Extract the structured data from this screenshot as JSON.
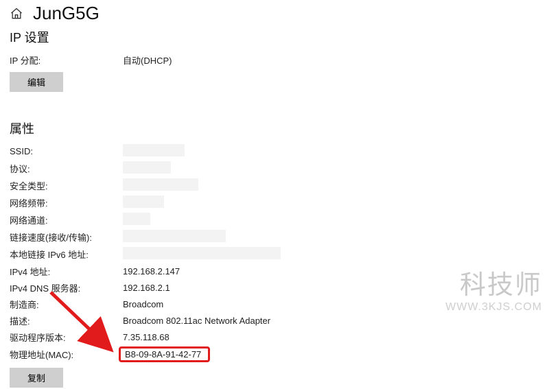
{
  "header": {
    "title": "JunG5G"
  },
  "ip_settings": {
    "heading": "IP 设置",
    "assignment_label": "IP 分配:",
    "assignment_value": "自动(DHCP)",
    "edit_button": "编辑"
  },
  "properties": {
    "heading": "属性",
    "rows": [
      {
        "label": "SSID:",
        "value": ""
      },
      {
        "label": "协议:",
        "value": ""
      },
      {
        "label": "安全类型:",
        "value": ""
      },
      {
        "label": "网络频带:",
        "value": ""
      },
      {
        "label": "网络通道:",
        "value": ""
      },
      {
        "label": "链接速度(接收/传输):",
        "value": ""
      },
      {
        "label": "本地链接 IPv6 地址:",
        "value": ""
      },
      {
        "label": "IPv4 地址:",
        "value": "192.168.2.147"
      },
      {
        "label": "IPv4 DNS 服务器:",
        "value": "192.168.2.1"
      },
      {
        "label": "制造商:",
        "value": "Broadcom"
      },
      {
        "label": "描述:",
        "value": "Broadcom 802.11ac Network Adapter"
      },
      {
        "label": "驱动程序版本:",
        "value": "7.35.118.68"
      },
      {
        "label": "物理地址(MAC):",
        "value": "B8-09-8A-91-42-77"
      }
    ],
    "copy_button": "复制"
  },
  "watermark": {
    "line1": "科技师",
    "line2": "WWW.3KJS.COM"
  }
}
